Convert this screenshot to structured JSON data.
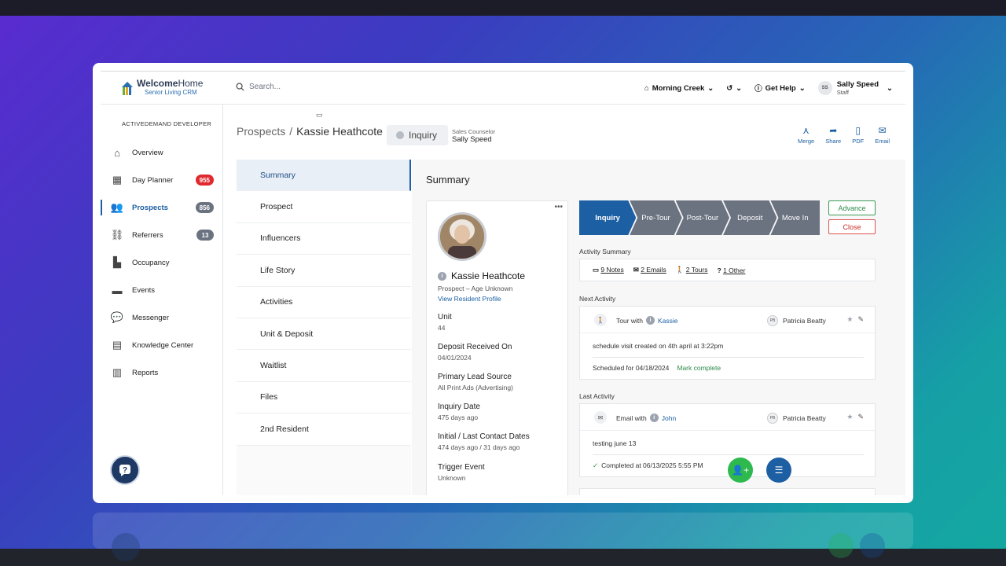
{
  "header": {
    "logo_bold": "Welcome",
    "logo_rest": "Home",
    "logo_sub": "Senior Living CRM",
    "search_placeholder": "Search...",
    "community": "Morning Creek",
    "help": "Get Help",
    "user_initials": "SS",
    "user_name": "Sally Speed",
    "user_role": "Staff"
  },
  "sidebar": {
    "org": "ACTIVEDEMAND DEVELOPER",
    "items": [
      {
        "label": "Overview",
        "icon": "home-icon"
      },
      {
        "label": "Day Planner",
        "icon": "calendar-icon",
        "badge": "955",
        "badge_color": "#e0292f"
      },
      {
        "label": "Prospects",
        "icon": "people-icon",
        "badge": "856",
        "badge_color": "#6b7280"
      },
      {
        "label": "Referrers",
        "icon": "handshake-icon",
        "badge": "13",
        "badge_color": "#6b7280"
      },
      {
        "label": "Occupancy",
        "icon": "building-icon"
      },
      {
        "label": "Events",
        "icon": "ticket-icon"
      },
      {
        "label": "Messenger",
        "icon": "chat-icon"
      },
      {
        "label": "Knowledge Center",
        "icon": "book-icon"
      },
      {
        "label": "Reports",
        "icon": "chart-icon"
      }
    ]
  },
  "page": {
    "breadcrumb": "Prospects",
    "name": "Kassie Heathcote",
    "status": "Inquiry",
    "counselor_label": "Sales Counselor",
    "counselor": "Sally Speed",
    "actions": [
      "Merge",
      "Share",
      "PDF",
      "Email"
    ]
  },
  "tabs": [
    "Summary",
    "Prospect",
    "Influencers",
    "Life Story",
    "Activities",
    "Unit & Deposit",
    "Waitlist",
    "Files",
    "2nd Resident"
  ],
  "summary": {
    "title": "Summary",
    "profile": {
      "name": "Kassie Heathcote",
      "sub": "Prospect – Age Unknown",
      "link": "View Resident Profile",
      "fields": [
        {
          "k": "Unit",
          "v": "44"
        },
        {
          "k": "Deposit Received On",
          "v": "04/01/2024"
        },
        {
          "k": "Primary Lead Source",
          "v": "All Print Ads (Advertising)"
        },
        {
          "k": "Inquiry Date",
          "v": "475 days ago"
        },
        {
          "k": "Initial / Last Contact Dates",
          "v": "474 days ago / 31 days ago"
        },
        {
          "k": "Trigger Event",
          "v": "Unknown"
        }
      ]
    },
    "stages": [
      "Inquiry",
      "Pre-Tour",
      "Post-Tour",
      "Deposit",
      "Move In"
    ],
    "advance": "Advance",
    "close": "Close",
    "activity_summary_label": "Activity Summary",
    "activity_summary": [
      "9 Notes",
      "2 Emails",
      "2 Tours",
      "1 Other"
    ],
    "next_label": "Next Activity",
    "next": {
      "type": "Tour with",
      "who": "Kassie",
      "owner_initials": "PB",
      "owner": "Patricia Beatty",
      "body": "schedule visit created on 4th april at 3:22pm",
      "scheduled": "Scheduled for 04/18/2024",
      "mark": "Mark complete"
    },
    "last_label": "Last Activity",
    "last": {
      "type": "Email with",
      "who": "John",
      "owner_initials": "PB",
      "owner": "Patricia Beatty",
      "body": "testing june 13",
      "completed": "Completed at 06/13/2025 5:55 PM"
    }
  }
}
